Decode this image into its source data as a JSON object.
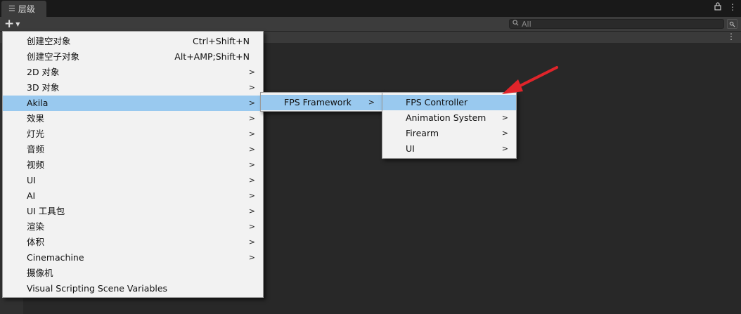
{
  "window": {
    "tab_icon": "list-icon",
    "tab_label": "层级",
    "lock_icon": "lock-icon",
    "more_icon": "kebab-menu-icon"
  },
  "toolbar": {
    "add_icon": "plus-icon",
    "search_placeholder": "All"
  },
  "menu": {
    "items": [
      {
        "label": "创建空对象",
        "shortcut": "Ctrl+Shift+N",
        "submenu": false
      },
      {
        "label": "创建空子对象",
        "shortcut": "Alt+AMP;Shift+N",
        "submenu": false
      },
      {
        "label": "2D 对象",
        "shortcut": "",
        "submenu": true
      },
      {
        "label": "3D 对象",
        "shortcut": "",
        "submenu": true
      },
      {
        "label": "Akila",
        "shortcut": "",
        "submenu": true,
        "selected": true
      },
      {
        "label": "效果",
        "shortcut": "",
        "submenu": true
      },
      {
        "label": "灯光",
        "shortcut": "",
        "submenu": true
      },
      {
        "label": "音频",
        "shortcut": "",
        "submenu": true
      },
      {
        "label": "视频",
        "shortcut": "",
        "submenu": true
      },
      {
        "label": "UI",
        "shortcut": "",
        "submenu": true
      },
      {
        "label": "AI",
        "shortcut": "",
        "submenu": true
      },
      {
        "label": "UI 工具包",
        "shortcut": "",
        "submenu": true
      },
      {
        "label": "渲染",
        "shortcut": "",
        "submenu": true
      },
      {
        "label": "体积",
        "shortcut": "",
        "submenu": true
      },
      {
        "label": "Cinemachine",
        "shortcut": "",
        "submenu": true
      },
      {
        "label": "摄像机",
        "shortcut": "",
        "submenu": false
      },
      {
        "label": "Visual Scripting Scene Variables",
        "shortcut": "",
        "submenu": false
      }
    ],
    "submenu_arrow": ">"
  },
  "akila_menu": {
    "items": [
      {
        "label": "FPS Framework",
        "submenu": true,
        "selected": true
      }
    ]
  },
  "fps_menu": {
    "items": [
      {
        "label": "FPS Controller",
        "submenu": false,
        "selected": true
      },
      {
        "label": "Animation System",
        "submenu": true
      },
      {
        "label": "Firearm",
        "submenu": true
      },
      {
        "label": "UI",
        "submenu": true
      }
    ]
  },
  "colors": {
    "selection": "#99c9ef",
    "menu_bg": "#f2f2f2",
    "annotation": "#e0242a"
  }
}
